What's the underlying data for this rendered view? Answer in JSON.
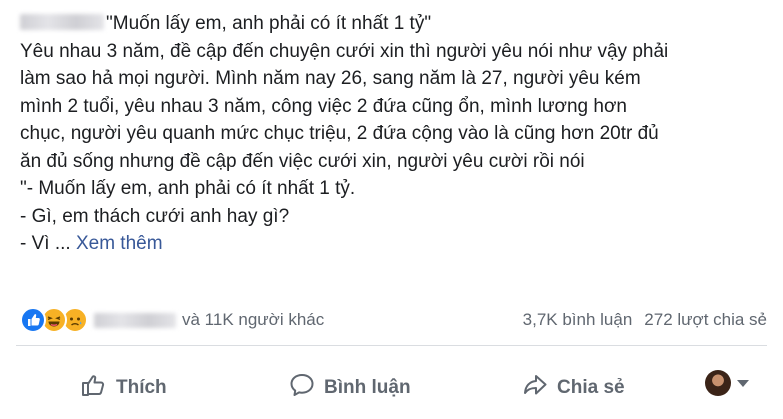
{
  "post": {
    "header_text": "\"Muốn lấy em, anh phải có ít nhất 1 tỷ\"",
    "lines": [
      "Yêu nhau 3 năm, đề cập đến chuyện cưới xin thì người yêu nói như vậy phải",
      "làm sao hả mọi người. Mình năm nay 26, sang năm là 27, người yêu kém",
      "mình 2 tuổi, yêu nhau 3 năm, công việc 2 đứa cũng ổn, mình lương hơn",
      "chục, người yêu quanh mức chục triệu, 2 đứa cộng vào là cũng hơn 20tr đủ",
      "ăn đủ sống nhưng đề cập đến việc cưới xin, người yêu cười rồi nói",
      "\"- Muốn lấy em, anh phải có ít nhất 1 tỷ.",
      "- Gì, em thách cưới anh hay gì?"
    ],
    "last_line_prefix": "- Vì ... ",
    "see_more": "Xem thêm"
  },
  "reactions": {
    "icons": [
      "like-icon",
      "haha-icon",
      "sad-icon"
    ],
    "others_text": "và 11K người khác",
    "comments": "3,7K bình luận",
    "shares": "272 lượt chia sẻ"
  },
  "actions": {
    "like": "Thích",
    "comment": "Bình luận",
    "share": "Chia sẻ"
  },
  "colors": {
    "link": "#385898",
    "muted": "#606770",
    "like_blue": "#1877f2",
    "emoji_yellow": "#f7b125"
  }
}
